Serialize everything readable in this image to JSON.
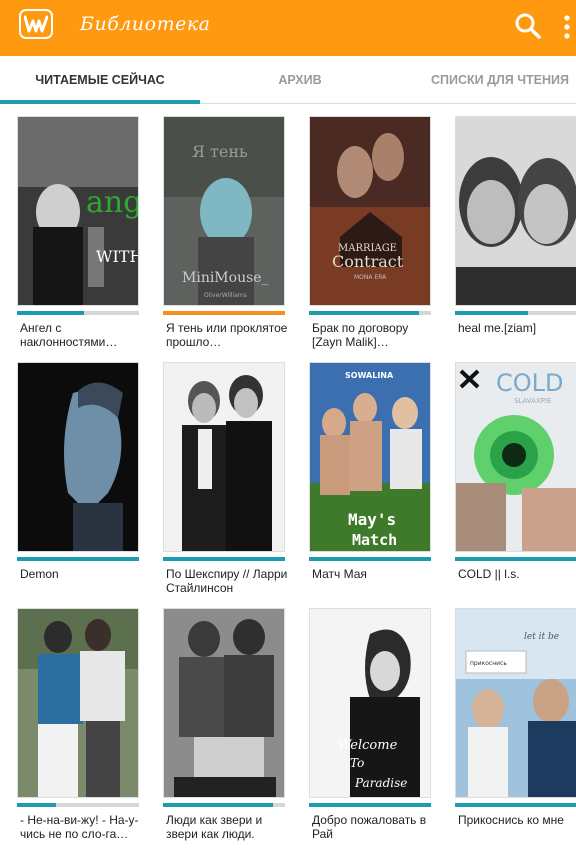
{
  "app": {
    "title": "Библиотека",
    "logo_icon": "wattpad-w-icon",
    "search_icon": "search-icon",
    "menu_icon": "overflow-menu-icon",
    "accent_color": "#ff9a10",
    "tab_indicator_color": "#1c9cae"
  },
  "tabs": [
    {
      "label": "ЧИТАЕМЫЕ СЕЙЧАС",
      "active": true
    },
    {
      "label": "АРХИВ",
      "active": false
    },
    {
      "label": "СПИСКИ ДЛЯ ЧТЕНИЯ",
      "active": false
    }
  ],
  "books": [
    {
      "title": "Ангел с наклонностями…",
      "cover_text": [
        "angel",
        "WITH"
      ],
      "progress": 0.55
    },
    {
      "title": "Я тень или проклятое прошло…",
      "cover_text": [
        "Я тень",
        "MiniMouse_",
        "OliverWilliams"
      ],
      "progress": 1.0,
      "progress_style": "orange"
    },
    {
      "title": "Брак по договору [Zayn Malik]…",
      "cover_text": [
        "MARRIAGE",
        "Contract",
        "MONA ERA"
      ],
      "progress": 0.9
    },
    {
      "title": "heal me.[ziam]",
      "cover_text": [],
      "progress": 0.6
    },
    {
      "title": "Demon",
      "cover_text": [],
      "progress": 1.0
    },
    {
      "title": "По Шекспиру // Ларри Стайлинсон",
      "cover_text": [],
      "progress": 1.0
    },
    {
      "title": "Матч Мая",
      "cover_text": [
        "SOWALINA",
        "May's",
        "Match"
      ],
      "progress": 1.0
    },
    {
      "title": "COLD || l.s.",
      "cover_text": [
        "COLD",
        "SLAVAXPIE"
      ],
      "progress": 1.0
    },
    {
      "title": "- Не-на-ви-жу! - На-у-чись не по сло-га…",
      "cover_text": [],
      "progress": 0.32
    },
    {
      "title": "Люди как звери и звери как люди.",
      "cover_text": [],
      "progress": 0.9
    },
    {
      "title": "Добро пожаловать в Рай",
      "cover_text": [
        "Welcome",
        "To",
        "Paradise"
      ],
      "progress": 1.0
    },
    {
      "title": "Прикоснись ко мне",
      "cover_text": [
        "let it be",
        "прикоснись"
      ],
      "progress": 1.0
    }
  ]
}
